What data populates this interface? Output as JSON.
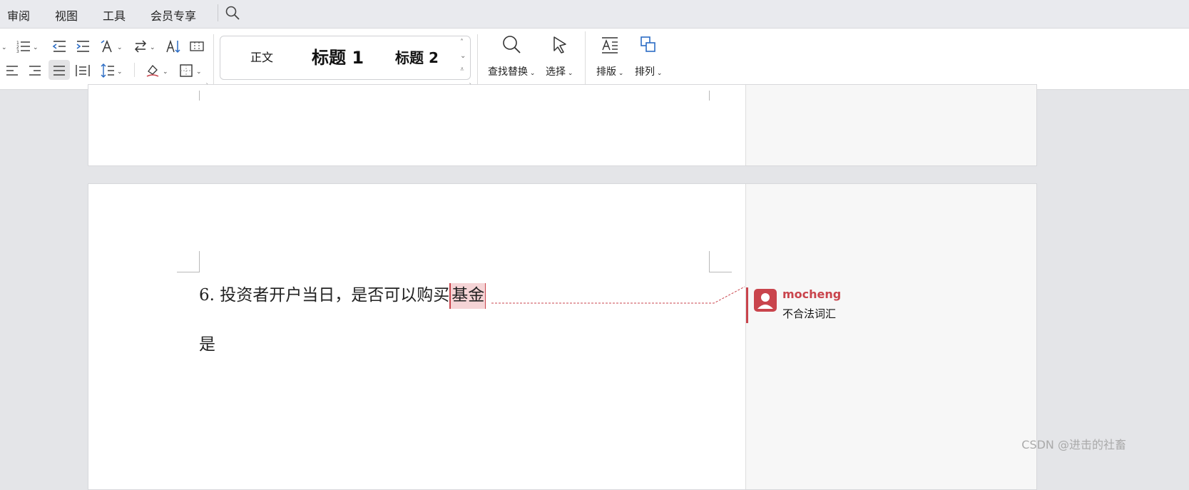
{
  "menubar": {
    "items": [
      "审阅",
      "视图",
      "工具",
      "会员专享"
    ]
  },
  "ribbon": {
    "styles": {
      "normal": "正文",
      "heading1": "标题 1",
      "heading2": "标题 2"
    },
    "find_replace_label": "查找替换",
    "select_label": "选择",
    "layout_label": "排版",
    "arrange_label": "排列"
  },
  "document": {
    "question_text": "6. 投资者开户当日，是否可以购买",
    "highlighted_text": "基金",
    "answer_text": "是"
  },
  "comment": {
    "author": "mocheng",
    "text": "不合法词汇"
  },
  "watermark": "CSDN @进击的社畜",
  "colors": {
    "accent": "#c9444c",
    "highlight": "#f5d4d6",
    "icon_blue": "#2b6cc4"
  }
}
